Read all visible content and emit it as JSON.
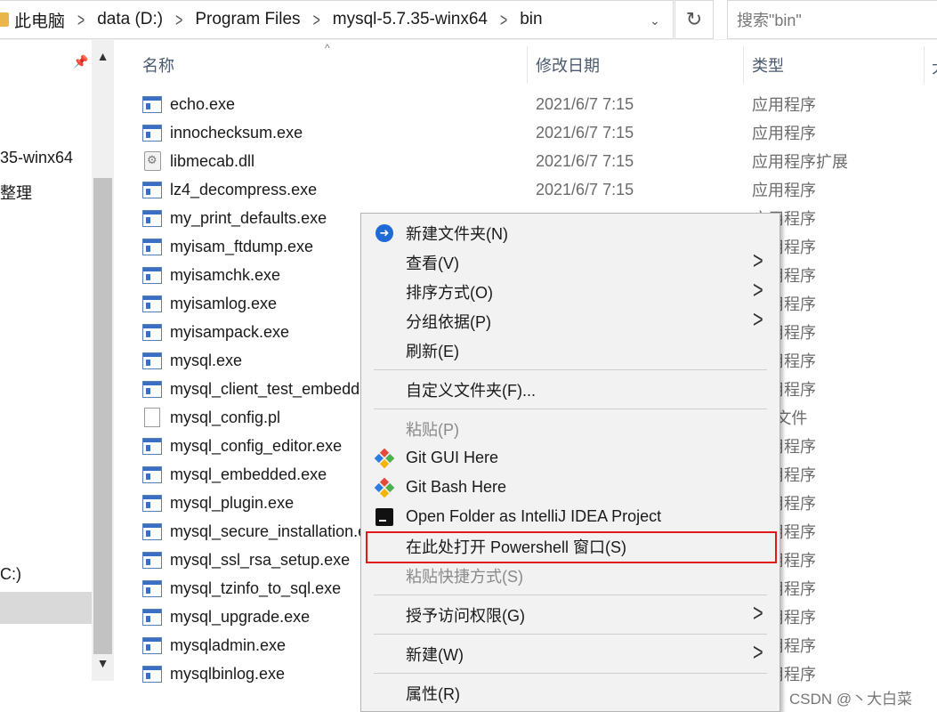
{
  "addressbar": {
    "breadcrumbs": [
      "此电脑",
      "data (D:)",
      "Program Files",
      "mysql-5.7.35-winx64",
      "bin"
    ],
    "search_placeholder": "搜索\"bin\""
  },
  "navpane": {
    "items": [
      {
        "label": "35-winx64"
      },
      {
        "label": "整理"
      },
      {
        "label": "C:)"
      }
    ]
  },
  "columns": {
    "name": "名称",
    "date": "修改日期",
    "type": "类型",
    "size_partial": "大"
  },
  "files": [
    {
      "name": "echo.exe",
      "date": "2021/6/7 7:15",
      "type": "应用程序",
      "icon": "exe"
    },
    {
      "name": "innochecksum.exe",
      "date": "2021/6/7 7:15",
      "type": "应用程序",
      "icon": "exe"
    },
    {
      "name": "libmecab.dll",
      "date": "2021/6/7 7:15",
      "type": "应用程序扩展",
      "icon": "dll"
    },
    {
      "name": "lz4_decompress.exe",
      "date": "2021/6/7 7:15",
      "type": "应用程序",
      "icon": "exe"
    },
    {
      "name": "my_print_defaults.exe",
      "date": "",
      "type": "应用程序",
      "icon": "exe"
    },
    {
      "name": "myisam_ftdump.exe",
      "date": "",
      "type": "应用程序",
      "icon": "exe"
    },
    {
      "name": "myisamchk.exe",
      "date": "",
      "type": "应用程序",
      "icon": "exe"
    },
    {
      "name": "myisamlog.exe",
      "date": "",
      "type": "应用程序",
      "icon": "exe"
    },
    {
      "name": "myisampack.exe",
      "date": "",
      "type": "应用程序",
      "icon": "exe"
    },
    {
      "name": "mysql.exe",
      "date": "",
      "type": "应用程序",
      "icon": "exe"
    },
    {
      "name": "mysql_client_test_embedded.exe",
      "date": "",
      "type": "应用程序",
      "icon": "exe"
    },
    {
      "name": "mysql_config.pl",
      "date": "",
      "type": "PL 文件",
      "icon": "pl"
    },
    {
      "name": "mysql_config_editor.exe",
      "date": "",
      "type": "应用程序",
      "icon": "exe"
    },
    {
      "name": "mysql_embedded.exe",
      "date": "",
      "type": "应用程序",
      "icon": "exe"
    },
    {
      "name": "mysql_plugin.exe",
      "date": "",
      "type": "应用程序",
      "icon": "exe"
    },
    {
      "name": "mysql_secure_installation.exe",
      "date": "",
      "type": "应用程序",
      "icon": "exe"
    },
    {
      "name": "mysql_ssl_rsa_setup.exe",
      "date": "",
      "type": "应用程序",
      "icon": "exe"
    },
    {
      "name": "mysql_tzinfo_to_sql.exe",
      "date": "",
      "type": "应用程序",
      "icon": "exe"
    },
    {
      "name": "mysql_upgrade.exe",
      "date": "",
      "type": "应用程序",
      "icon": "exe"
    },
    {
      "name": "mysqladmin.exe",
      "date": "",
      "type": "应用程序",
      "icon": "exe"
    },
    {
      "name": "mysqlbinlog.exe",
      "date": "",
      "type": "应用程序",
      "icon": "exe"
    }
  ],
  "context_menu": {
    "items": [
      {
        "label": "新建文件夹(N)",
        "icon": "new-folder-icon"
      },
      {
        "label": "查看(V)",
        "submenu": true
      },
      {
        "label": "排序方式(O)",
        "submenu": true
      },
      {
        "label": "分组依据(P)",
        "submenu": true
      },
      {
        "label": "刷新(E)"
      },
      {
        "label": "自定义文件夹(F)..."
      },
      {
        "label": "粘贴(P)",
        "disabled": true
      },
      {
        "label": "Git GUI Here",
        "icon": "git-icon"
      },
      {
        "label": "Git Bash Here",
        "icon": "git-icon"
      },
      {
        "label": "Open Folder as IntelliJ IDEA Project",
        "icon": "intellij-icon"
      },
      {
        "label": "在此处打开 Powershell 窗口(S)"
      },
      {
        "label": "粘贴快捷方式(S)",
        "disabled": true
      },
      {
        "label": "授予访问权限(G)",
        "submenu": true
      },
      {
        "label": "新建(W)",
        "submenu": true
      },
      {
        "label": "属性(R)"
      }
    ]
  },
  "colors": {
    "highlight": "#e01919",
    "accent": "#1e6ad6"
  },
  "watermark": "CSDN @丶大白菜"
}
